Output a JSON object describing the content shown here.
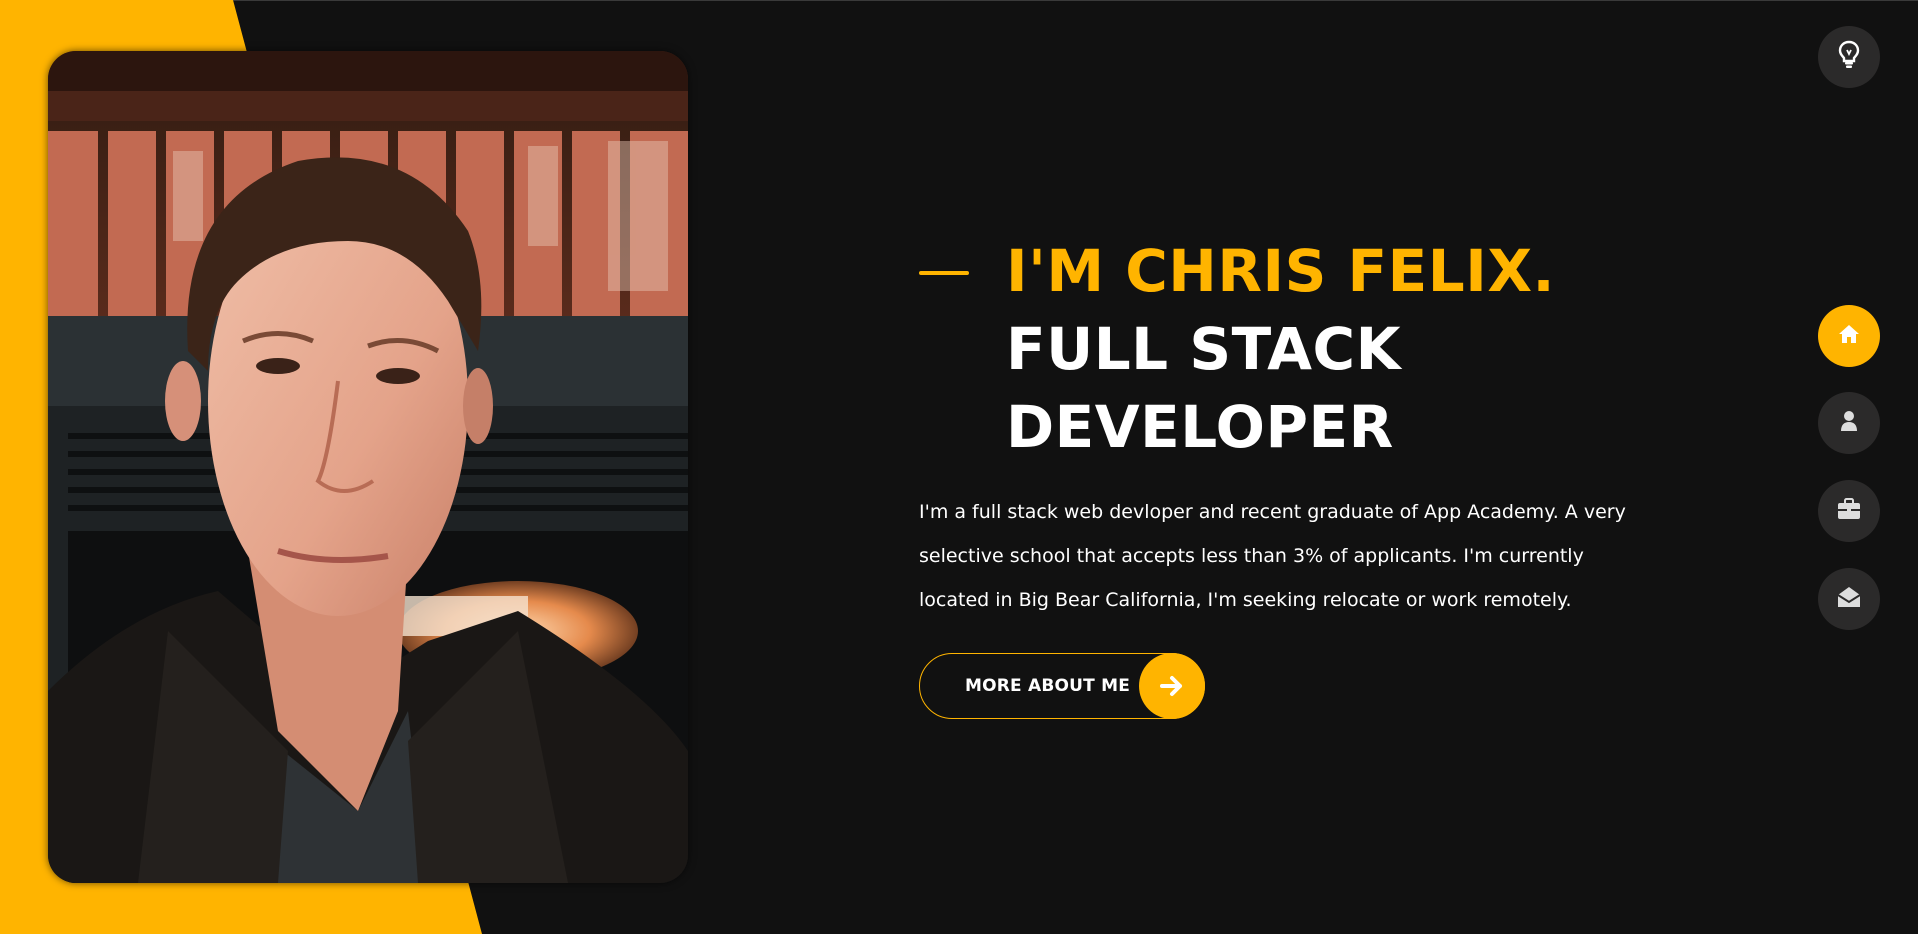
{
  "colors": {
    "accent": "#ffb400",
    "background": "#111111",
    "nav_button_bg": "#2b2a2a",
    "text": "#ffffff"
  },
  "profile": {
    "photo_alt": "Chris Felix"
  },
  "hero": {
    "name_line": "I'M CHRIS FELIX.",
    "role_line": "FULL STACK DEVELOPER",
    "description": "I'm a full stack web devloper and recent graduate of App Academy. A very selective school that accepts less than 3% of applicants. I'm currently located in Big Bear California, I'm seeking relocate or work remotely.",
    "button_label": "MORE ABOUT ME",
    "button_icon": "arrow-right-icon"
  },
  "theme_toggle": {
    "icon": "lightbulb-icon"
  },
  "nav": {
    "items": [
      {
        "id": "home",
        "icon": "home-icon",
        "active": true
      },
      {
        "id": "about",
        "icon": "user-icon",
        "active": false
      },
      {
        "id": "portfolio",
        "icon": "briefcase-icon",
        "active": false
      },
      {
        "id": "contact",
        "icon": "envelope-open-icon",
        "active": false
      }
    ]
  }
}
